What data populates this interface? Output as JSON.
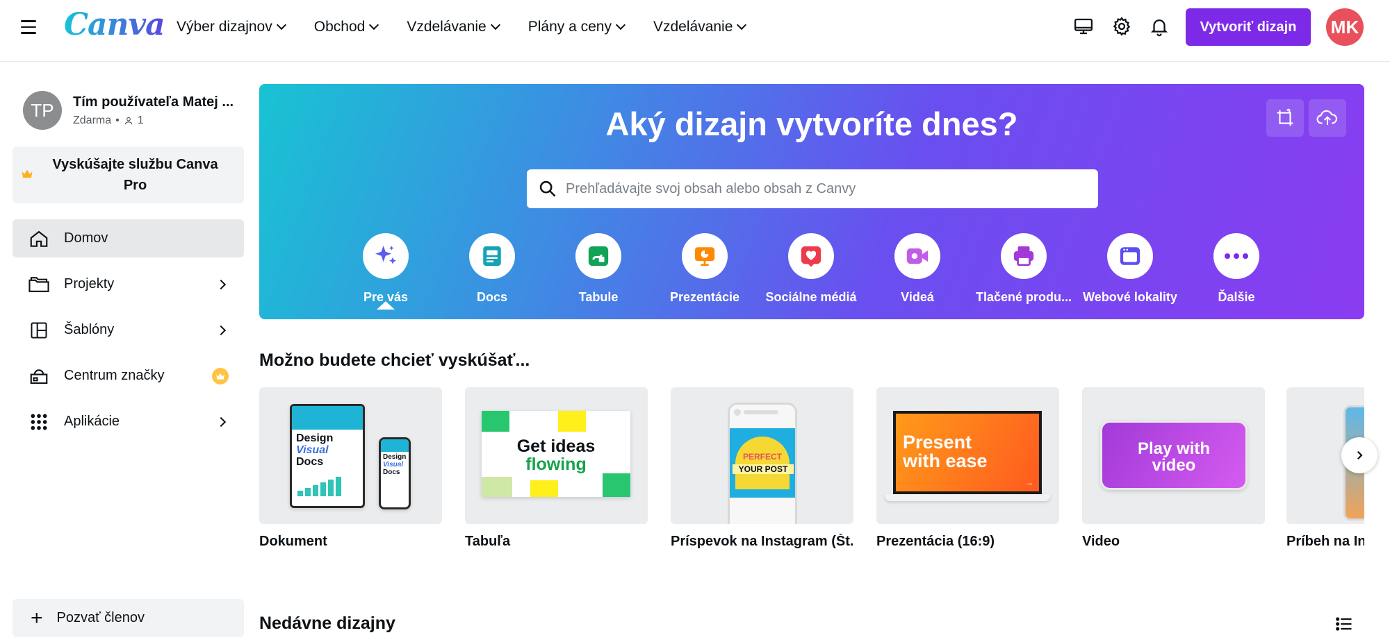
{
  "topbar": {
    "logo": "Canva",
    "nav": [
      {
        "label": "Výber dizajnov"
      },
      {
        "label": "Obchod"
      },
      {
        "label": "Vzdelávanie"
      },
      {
        "label": "Plány a ceny"
      },
      {
        "label": "Vzdelávanie"
      }
    ],
    "icons": [
      "monitor-icon",
      "gear-icon",
      "bell-icon"
    ],
    "create_label": "Vytvoriť dizajn",
    "avatar_initials": "MK",
    "avatar_color": "#e8505b",
    "accent": "#7d2ae8"
  },
  "sidebar": {
    "team_initials": "TP",
    "team_name": "Tím používateľa Matej ...",
    "team_plan": "Zdarma",
    "team_members": "1",
    "pro_label": "Vyskúšajte službu Canva Pro",
    "items": [
      {
        "label": "Domov",
        "icon": "home-icon"
      },
      {
        "label": "Projekty",
        "icon": "folder-icon"
      },
      {
        "label": "Šablóny",
        "icon": "template-icon"
      },
      {
        "label": "Centrum značky",
        "icon": "brand-icon"
      },
      {
        "label": "Aplikácie",
        "icon": "apps-grid-icon"
      }
    ],
    "invite_label": "Pozvať členov"
  },
  "hero": {
    "title": "Aký dizajn vytvoríte dnes?",
    "search_placeholder": "Prehľadávajte svoj obsah alebo obsah z Canvy",
    "categories": [
      {
        "label": "Pre vás",
        "icon": "sparkle-icon",
        "color": "#5b5bf0"
      },
      {
        "label": "Docs",
        "icon": "docs-icon",
        "color": "#13a3b5"
      },
      {
        "label": "Tabule",
        "icon": "whiteboard-icon",
        "color": "#13a357"
      },
      {
        "label": "Prezentácie",
        "icon": "presentation-icon",
        "color": "#ff8a00"
      },
      {
        "label": "Sociálne médiá",
        "icon": "heart-icon",
        "color": "#ee3b4b"
      },
      {
        "label": "Videá",
        "icon": "video-icon",
        "color": "#c25ce8"
      },
      {
        "label": "Tlačené produ...",
        "icon": "printer-icon",
        "color": "#a23ad8"
      },
      {
        "label": "Webové lokality",
        "icon": "website-icon",
        "color": "#5e4ef0"
      },
      {
        "label": "Ďalšie",
        "icon": "more-icon",
        "color": "#7d2ae8"
      }
    ]
  },
  "suggestions": {
    "title": "Možno budete chcieť vyskúšať...",
    "cards": [
      {
        "label": "Dokument",
        "thumb_text_1": "Design",
        "thumb_text_2": "Visual",
        "thumb_text_3": "Docs"
      },
      {
        "label": "Tabuľa",
        "thumb_text_1": "Get ideas",
        "thumb_text_2": "flowing"
      },
      {
        "label": "Príspevok na Instagram (Št...",
        "thumb_text_1": "PERFECT",
        "thumb_text_2": "YOUR POST"
      },
      {
        "label": "Prezentácia (16:9)",
        "thumb_text_1": "Present",
        "thumb_text_2": "with ease"
      },
      {
        "label": "Video",
        "thumb_text_1": "Play with",
        "thumb_text_2": "video"
      },
      {
        "label": "Príbeh na In"
      }
    ]
  },
  "recent": {
    "title": "Nedávne dizajny"
  }
}
